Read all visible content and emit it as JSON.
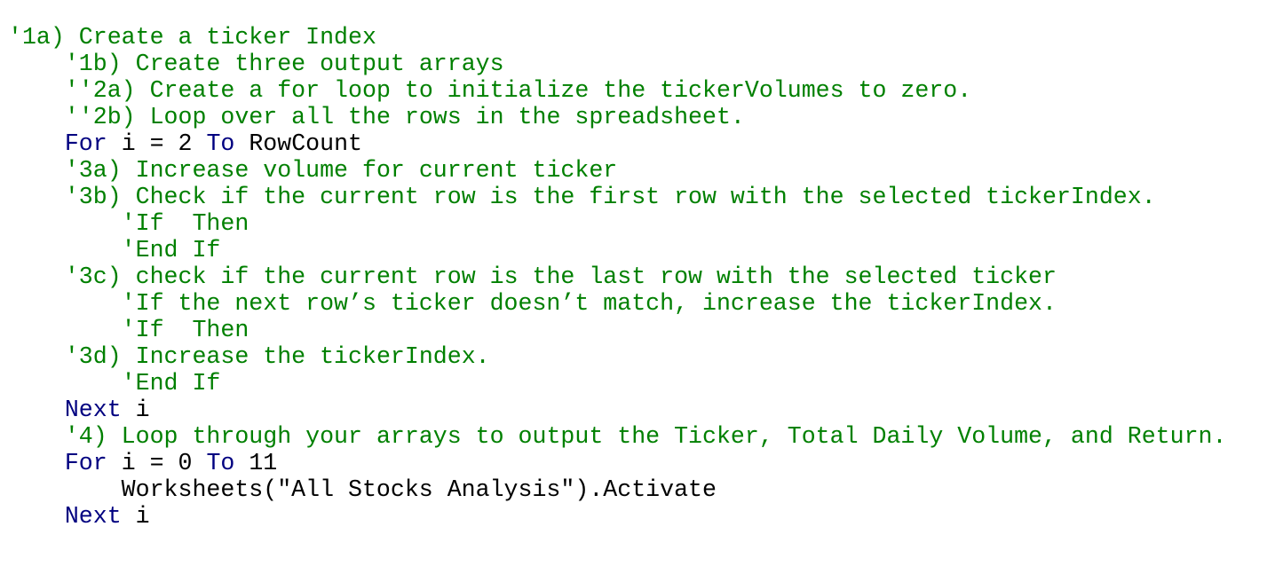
{
  "editor": {
    "colors": {
      "comment": "#008000",
      "keyword": "#000080",
      "plain": "#000000",
      "background": "#ffffff"
    },
    "lines": [
      {
        "indent": "",
        "parts": [
          {
            "kind": "comment",
            "text": "'1a) Create a ticker Index"
          }
        ]
      },
      {
        "indent": "    ",
        "parts": [
          {
            "kind": "comment",
            "text": "'1b) Create three output arrays"
          }
        ]
      },
      {
        "indent": "    ",
        "parts": [
          {
            "kind": "comment",
            "text": "''2a) Create a for loop to initialize the tickerVolumes to zero."
          }
        ]
      },
      {
        "indent": "    ",
        "parts": [
          {
            "kind": "comment",
            "text": "''2b) Loop over all the rows in the spreadsheet."
          }
        ]
      },
      {
        "indent": "    ",
        "parts": [
          {
            "kind": "kw",
            "text": "For"
          },
          {
            "kind": "plain",
            "text": " i = 2 "
          },
          {
            "kind": "kw",
            "text": "To"
          },
          {
            "kind": "plain",
            "text": " RowCount"
          }
        ]
      },
      {
        "indent": "    ",
        "parts": [
          {
            "kind": "comment",
            "text": "'3a) Increase volume for current ticker"
          }
        ]
      },
      {
        "indent": "    ",
        "parts": [
          {
            "kind": "comment",
            "text": "'3b) Check if the current row is the first row with the selected tickerIndex."
          }
        ]
      },
      {
        "indent": "        ",
        "parts": [
          {
            "kind": "comment",
            "text": "'If  Then"
          }
        ]
      },
      {
        "indent": "        ",
        "parts": [
          {
            "kind": "comment",
            "text": "'End If"
          }
        ]
      },
      {
        "indent": "    ",
        "parts": [
          {
            "kind": "comment",
            "text": "'3c) check if the current row is the last row with the selected ticker"
          }
        ]
      },
      {
        "indent": "        ",
        "parts": [
          {
            "kind": "comment",
            "text": "'If the next row’s ticker doesn’t match, increase the tickerIndex."
          }
        ]
      },
      {
        "indent": "        ",
        "parts": [
          {
            "kind": "comment",
            "text": "'If  Then"
          }
        ]
      },
      {
        "indent": "    ",
        "parts": [
          {
            "kind": "comment",
            "text": "'3d) Increase the tickerIndex."
          }
        ]
      },
      {
        "indent": "        ",
        "parts": [
          {
            "kind": "comment",
            "text": "'End If"
          }
        ]
      },
      {
        "indent": "    ",
        "parts": [
          {
            "kind": "kw",
            "text": "Next"
          },
          {
            "kind": "plain",
            "text": " i"
          }
        ]
      },
      {
        "indent": "    ",
        "parts": [
          {
            "kind": "comment",
            "text": "'4) Loop through your arrays to output the Ticker, Total Daily Volume, and Return."
          }
        ]
      },
      {
        "indent": "    ",
        "parts": [
          {
            "kind": "kw",
            "text": "For"
          },
          {
            "kind": "plain",
            "text": " i = 0 "
          },
          {
            "kind": "kw",
            "text": "To"
          },
          {
            "kind": "plain",
            "text": " 11"
          }
        ]
      },
      {
        "indent": "        ",
        "parts": [
          {
            "kind": "plain",
            "text": "Worksheets(\"All Stocks Analysis\").Activate"
          }
        ]
      },
      {
        "indent": "    ",
        "parts": [
          {
            "kind": "kw",
            "text": "Next"
          },
          {
            "kind": "plain",
            "text": " i"
          }
        ]
      }
    ]
  }
}
